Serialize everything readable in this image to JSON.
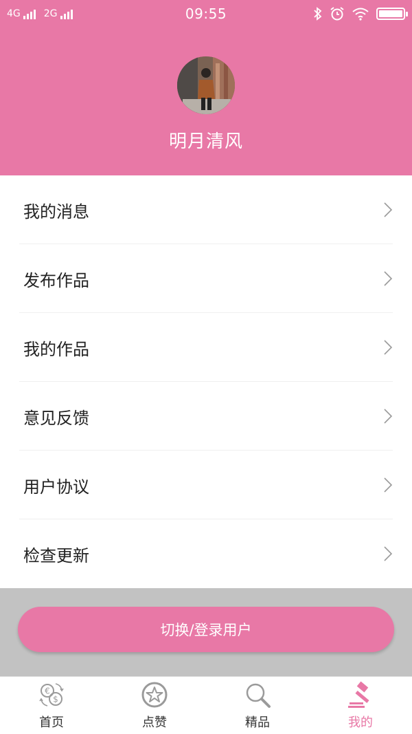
{
  "status_bar": {
    "network_1": "4G",
    "network_2": "2G",
    "time": "09:55"
  },
  "profile": {
    "username": "明月清风"
  },
  "menu": {
    "items": [
      {
        "label": "我的消息"
      },
      {
        "label": "发布作品"
      },
      {
        "label": "我的作品"
      },
      {
        "label": "意见反馈"
      },
      {
        "label": "用户协议"
      },
      {
        "label": "检查更新"
      }
    ]
  },
  "login_button": {
    "label": "切换/登录用户"
  },
  "tabbar": {
    "tabs": [
      {
        "label": "首页",
        "icon": "currency-exchange-icon"
      },
      {
        "label": "点赞",
        "icon": "star-icon"
      },
      {
        "label": "精品",
        "icon": "search-icon"
      },
      {
        "label": "我的",
        "icon": "gavel-icon",
        "active": true
      }
    ]
  },
  "colors": {
    "accent": "#e878a6",
    "inactive_icon": "#9a9a9a"
  }
}
